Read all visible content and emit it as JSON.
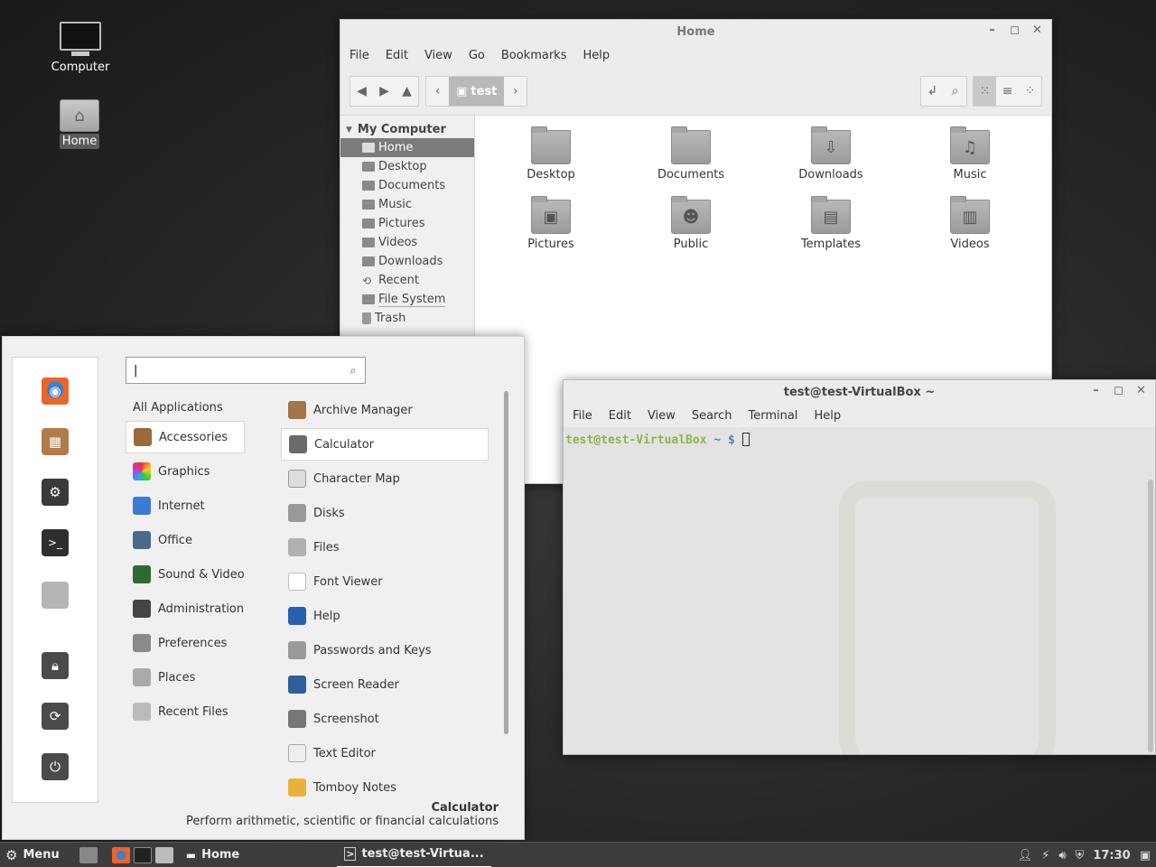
{
  "desktop": {
    "icons": [
      {
        "label": "Computer"
      },
      {
        "label": "Home"
      }
    ]
  },
  "file_manager": {
    "title": "Home",
    "menu": [
      "File",
      "Edit",
      "View",
      "Go",
      "Bookmarks",
      "Help"
    ],
    "breadcrumb": "test",
    "sidebar_section": "My Computer",
    "sidebar_items": [
      "Home",
      "Desktop",
      "Documents",
      "Music",
      "Pictures",
      "Videos",
      "Downloads",
      "Recent",
      "File System",
      "Trash"
    ],
    "folders": [
      "Desktop",
      "Documents",
      "Downloads",
      "Music",
      "Pictures",
      "Public",
      "Templates",
      "Videos"
    ]
  },
  "terminal": {
    "title": "test@test-VirtualBox ~",
    "menu": [
      "File",
      "Edit",
      "View",
      "Search",
      "Terminal",
      "Help"
    ],
    "prompt_user": "test@test-VirtualBox",
    "prompt_path": "~ $"
  },
  "start_menu": {
    "search_value": "|",
    "categories": [
      "All Applications",
      "Accessories",
      "Graphics",
      "Internet",
      "Office",
      "Sound & Video",
      "Administration",
      "Preferences",
      "Places",
      "Recent Files"
    ],
    "apps": [
      "Archive Manager",
      "Calculator",
      "Character Map",
      "Disks",
      "Files",
      "Font Viewer",
      "Help",
      "Passwords and Keys",
      "Screen Reader",
      "Screenshot",
      "Text Editor",
      "Tomboy Notes"
    ],
    "selected_app": "Calculator",
    "description_title": "Calculator",
    "description_text": "Perform arithmetic, scientific or financial calculations"
  },
  "taskbar": {
    "menu_label": "Menu",
    "windows": [
      {
        "label": "Home"
      },
      {
        "label": "test@test-Virtua..."
      }
    ],
    "clock": "17:30"
  }
}
